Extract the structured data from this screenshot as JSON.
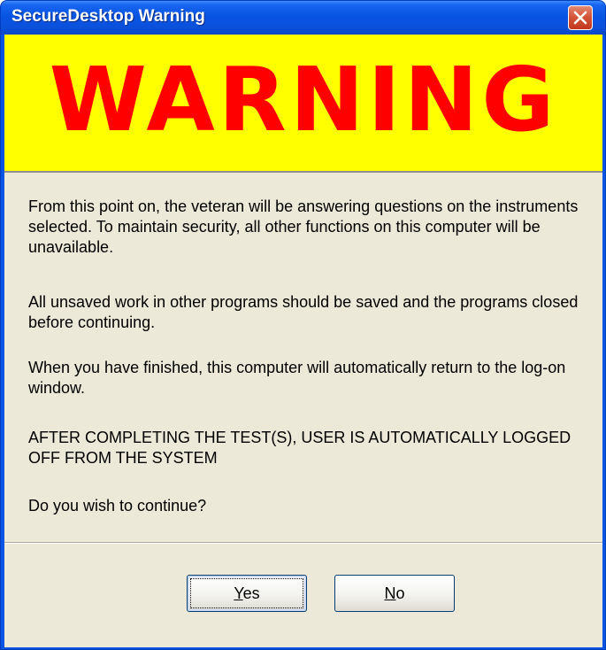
{
  "window": {
    "title": "SecureDesktop Warning",
    "close_icon": "close-icon"
  },
  "banner": {
    "text": "WARNING",
    "background": "#ffff00",
    "color": "#ff0000"
  },
  "message": {
    "paragraph_1": "From this point on, the veteran will be answering questions on the instruments selected. To maintain security, all other functions on this computer will be unavailable.",
    "paragraph_2": "All unsaved work in other programs should be saved and the programs closed before continuing.",
    "paragraph_3": "When you have finished, this computer will automatically return to the log-on window.",
    "paragraph_4": "AFTER COMPLETING THE TEST(S), USER IS AUTOMATICALLY LOGGED OFF FROM THE SYSTEM",
    "question": "Do you wish to continue?"
  },
  "buttons": {
    "yes_mnemonic": "Y",
    "yes_rest": "es",
    "no_mnemonic": "N",
    "no_rest": "o"
  },
  "colors": {
    "titlebar": "#0a54e3",
    "dialog_background": "#ece9d8"
  }
}
